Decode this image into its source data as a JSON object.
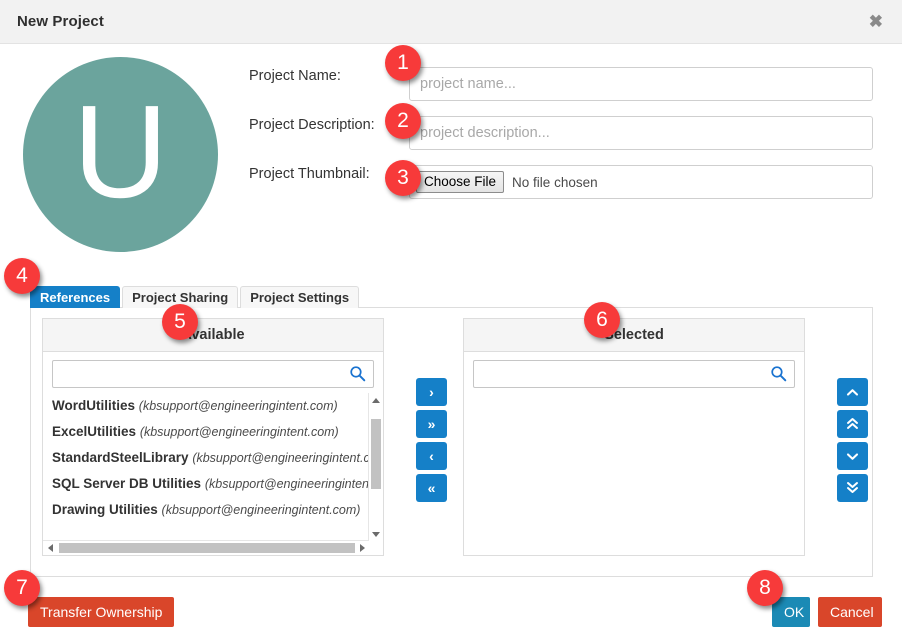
{
  "window": {
    "title": "New Project",
    "close_label": "✖"
  },
  "avatar": {
    "letter": "U",
    "color": "#6ba49d"
  },
  "form": {
    "name": {
      "label": "Project Name:",
      "placeholder": "project name...",
      "value": ""
    },
    "description": {
      "label": "Project Description:",
      "placeholder": "project description...",
      "value": ""
    },
    "thumbnail": {
      "label": "Project Thumbnail:",
      "button_label": "Choose File",
      "file_status": "No file chosen"
    }
  },
  "tabs": [
    {
      "label": "References",
      "active": true
    },
    {
      "label": "Project Sharing",
      "active": false
    },
    {
      "label": "Project Settings",
      "active": false
    }
  ],
  "dual_list": {
    "available": {
      "header": "Available",
      "search_placeholder": "",
      "search_value": "",
      "search_icon": "search-icon",
      "items": [
        {
          "name": "WordUtilities",
          "email": "(kbsupport@engineeringintent.com)"
        },
        {
          "name": "ExcelUtilities",
          "email": "(kbsupport@engineeringintent.com)"
        },
        {
          "name": "StandardSteelLibrary",
          "email": "(kbsupport@engineeringintent.com)"
        },
        {
          "name": "SQL Server DB Utilities",
          "email": "(kbsupport@engineeringintent.com)"
        },
        {
          "name": "Drawing Utilities",
          "email": "(kbsupport@engineeringintent.com)"
        }
      ]
    },
    "selected": {
      "header": "Selected",
      "search_placeholder": "",
      "search_value": "",
      "search_icon": "search-icon",
      "items": []
    },
    "move_buttons": [
      {
        "label": "›",
        "name": "move-right-button"
      },
      {
        "label": "»",
        "name": "move-all-right-button"
      },
      {
        "label": "‹",
        "name": "move-left-button"
      },
      {
        "label": "«",
        "name": "move-all-left-button"
      }
    ],
    "reorder_buttons": [
      {
        "label": "⌃",
        "name": "move-up-button"
      },
      {
        "label": "«",
        "name": "move-top-button"
      },
      {
        "label": "⌄",
        "name": "move-down-button"
      },
      {
        "label": "»",
        "name": "move-bottom-button"
      }
    ]
  },
  "footer": {
    "transfer_ownership_label": "Transfer Ownership",
    "ok_label": "OK",
    "cancel_label": "Cancel"
  },
  "colors": {
    "accent_blue": "#1580c8",
    "primary_blue": "#1b8ab5",
    "danger_red": "#d9462a",
    "badge_red": "#f73a3a",
    "avatar_teal": "#6ba49d"
  },
  "callouts": [
    {
      "number": "1"
    },
    {
      "number": "2"
    },
    {
      "number": "3"
    },
    {
      "number": "4"
    },
    {
      "number": "5"
    },
    {
      "number": "6"
    },
    {
      "number": "7"
    },
    {
      "number": "8"
    }
  ]
}
